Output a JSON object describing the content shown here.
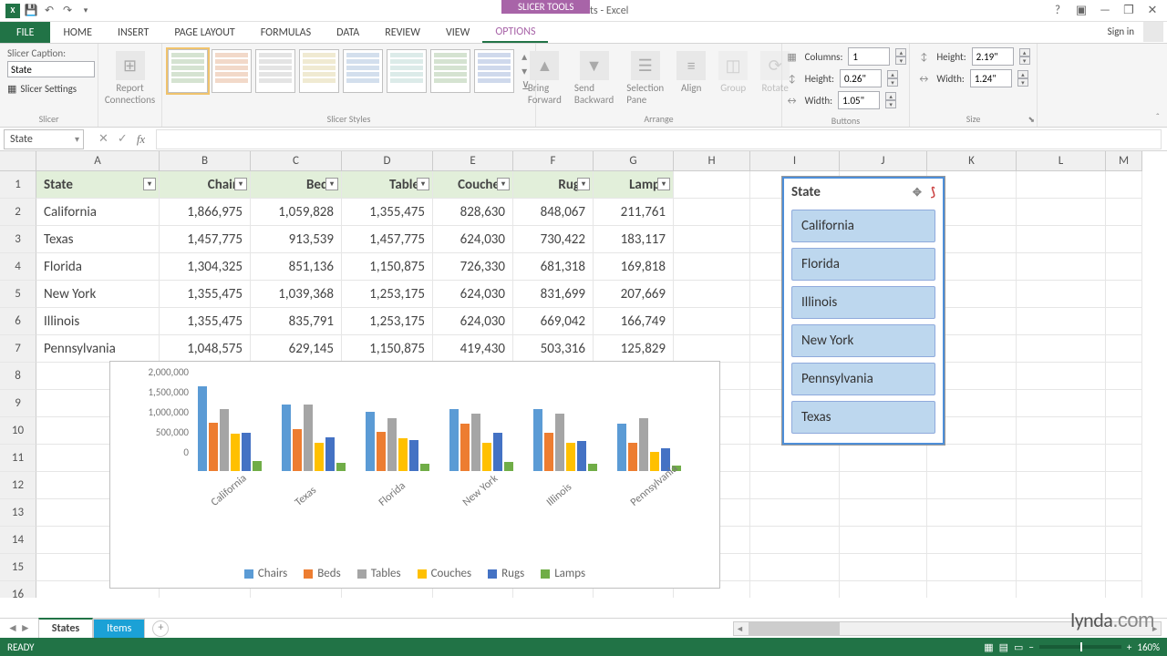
{
  "app": {
    "title": "Slicers with Charts - Excel",
    "context_tool": "SLICER TOOLS"
  },
  "qat": {
    "save": "save",
    "undo": "undo",
    "redo": "redo"
  },
  "win": {
    "help": "?",
    "opts": "▣",
    "min": "—",
    "restore": "❐",
    "close": "✕"
  },
  "tabs": [
    "FILE",
    "HOME",
    "INSERT",
    "PAGE LAYOUT",
    "FORMULAS",
    "DATA",
    "REVIEW",
    "VIEW",
    "OPTIONS"
  ],
  "signin": "Sign in",
  "ribbon": {
    "slicer_caption_label": "Slicer Caption:",
    "slicer_caption_value": "State",
    "slicer_settings": "Slicer Settings",
    "report_connections": "Report\nConnections",
    "group_labels": {
      "slicer": "Slicer",
      "styles": "Slicer Styles",
      "arrange": "Arrange",
      "buttons": "Buttons",
      "size": "Size"
    },
    "arrange": {
      "bring": "Bring\nForward",
      "send": "Send\nBackward",
      "selpane": "Selection\nPane",
      "align": "Align",
      "group": "Group",
      "rotate": "Rotate"
    },
    "buttons": {
      "columns": "Columns:",
      "columns_v": "1",
      "height": "Height:",
      "height_v": "0.26\"",
      "width": "Width:",
      "width_v": "1.05\""
    },
    "size": {
      "height": "Height:",
      "height_v": "2.19\"",
      "width": "Width:",
      "width_v": "1.24\""
    }
  },
  "namebox": "State",
  "columns": [
    "A",
    "B",
    "C",
    "D",
    "E",
    "F",
    "G",
    "H",
    "I",
    "J",
    "K",
    "L",
    "M"
  ],
  "headers": [
    "State",
    "Chairs",
    "Beds",
    "Tables",
    "Couches",
    "Rugs",
    "Lamps"
  ],
  "rows": [
    {
      "n": 1
    },
    {
      "n": 2
    },
    {
      "n": 3
    },
    {
      "n": 4
    },
    {
      "n": 5
    },
    {
      "n": 6
    },
    {
      "n": 7
    },
    {
      "n": 8
    },
    {
      "n": 9
    },
    {
      "n": 10
    },
    {
      "n": 11
    },
    {
      "n": 12
    },
    {
      "n": 13
    },
    {
      "n": 14
    },
    {
      "n": 15
    },
    {
      "n": 16
    }
  ],
  "table": [
    [
      "California",
      "1,866,975",
      "1,059,828",
      "1,355,475",
      "828,630",
      "848,067",
      "211,761"
    ],
    [
      "Texas",
      "1,457,775",
      "913,539",
      "1,457,775",
      "624,030",
      "730,422",
      "183,117"
    ],
    [
      "Florida",
      "1,304,325",
      "851,136",
      "1,150,875",
      "726,330",
      "681,318",
      "169,818"
    ],
    [
      "New York",
      "1,355,475",
      "1,039,368",
      "1,253,175",
      "624,030",
      "831,699",
      "207,669"
    ],
    [
      "Illinois",
      "1,355,475",
      "835,791",
      "1,253,175",
      "624,030",
      "669,042",
      "166,749"
    ],
    [
      "Pennsylvania",
      "1,048,575",
      "629,145",
      "1,150,875",
      "419,430",
      "503,316",
      "125,829"
    ]
  ],
  "slicer": {
    "title": "State",
    "items": [
      "California",
      "Florida",
      "Illinois",
      "New York",
      "Pennsylvania",
      "Texas"
    ]
  },
  "chart_data": {
    "type": "bar",
    "categories": [
      "California",
      "Texas",
      "Florida",
      "New York",
      "Illinois",
      "Pennsylvania"
    ],
    "series": [
      {
        "name": "Chairs",
        "values": [
          1866975,
          1457775,
          1304325,
          1355475,
          1355475,
          1048575
        ]
      },
      {
        "name": "Beds",
        "values": [
          1059828,
          913539,
          851136,
          1039368,
          835791,
          629145
        ]
      },
      {
        "name": "Tables",
        "values": [
          1355475,
          1457775,
          1150875,
          1253175,
          1253175,
          1150875
        ]
      },
      {
        "name": "Couches",
        "values": [
          828630,
          624030,
          726330,
          624030,
          624030,
          419430
        ]
      },
      {
        "name": "Rugs",
        "values": [
          848067,
          730422,
          681318,
          831699,
          669042,
          503316
        ]
      },
      {
        "name": "Lamps",
        "values": [
          211761,
          183117,
          169818,
          207669,
          166749,
          125829
        ]
      }
    ],
    "y_ticks": [
      "2,000,000",
      "1,500,000",
      "1,000,000",
      "500,000",
      "0"
    ],
    "ylim": [
      0,
      2000000
    ],
    "legend": [
      "Chairs",
      "Beds",
      "Tables",
      "Couches",
      "Rugs",
      "Lamps"
    ]
  },
  "sheets": {
    "tabs": [
      "States",
      "Items"
    ],
    "active": "States"
  },
  "status": {
    "ready": "READY",
    "zoom": "160%"
  },
  "watermark": "lynda.com"
}
